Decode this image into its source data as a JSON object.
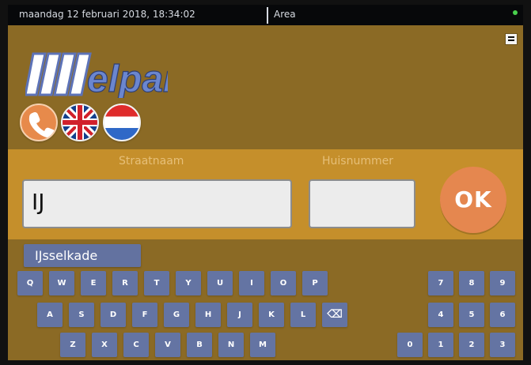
{
  "status": {
    "datetime": "maandag 12 februari 2018, 18:34:02",
    "area": "Area"
  },
  "brand": {
    "logo_text": "elpar"
  },
  "fields": {
    "street_label": "Straatnaam",
    "house_label": "Huisnummer",
    "street_value": "IJ",
    "house_value": ""
  },
  "actions": {
    "ok_label": "OK"
  },
  "suggestion": {
    "label": "IJsselkade"
  },
  "keyboard": {
    "row1": [
      "Q",
      "W",
      "E",
      "R",
      "T",
      "Y",
      "U",
      "I",
      "O",
      "P"
    ],
    "row2": [
      "A",
      "S",
      "D",
      "F",
      "G",
      "H",
      "J",
      "K",
      "L"
    ],
    "row3": [
      "Z",
      "X",
      "C",
      "V",
      "B",
      "N",
      "M"
    ],
    "backspace_symbol": "⌫",
    "numpad": [
      "7",
      "8",
      "9",
      "4",
      "5",
      "6",
      "0",
      "1",
      "2",
      "3"
    ]
  },
  "colors": {
    "background": "#8b6a25",
    "panel": "#c58f2b",
    "key": "#6474a3",
    "ok": "#e5874f"
  },
  "icons": [
    "menu-icon",
    "phone-icon",
    "uk-flag-icon",
    "nl-flag-icon",
    "backspace-icon",
    "status-indicator-icon"
  ]
}
